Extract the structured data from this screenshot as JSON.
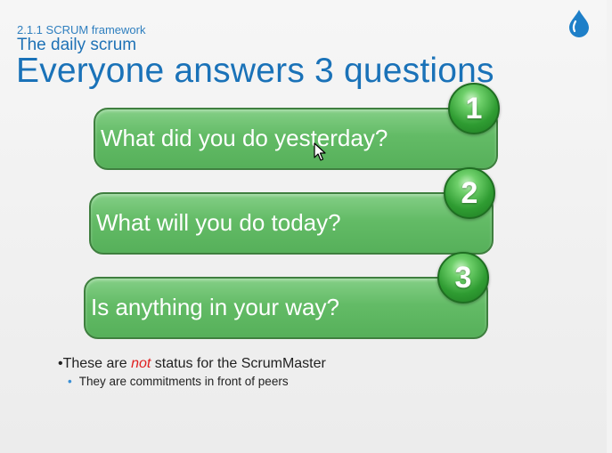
{
  "slide": {
    "section_label": "2.1.1 SCRUM framework",
    "subtitle": "The daily scrum",
    "title": "Everyone answers 3 questions"
  },
  "questions": [
    {
      "number": "1",
      "text": "What did you do yesterday?"
    },
    {
      "number": "2",
      "text": "What will you do today?"
    },
    {
      "number": "3",
      "text": "Is anything in your way?"
    }
  ],
  "bullets": {
    "main_prefix": "•These are ",
    "main_emphasis": "not",
    "main_suffix": " status for the ScrumMaster",
    "sub_marker": "•",
    "sub": "They are commitments in front of peers"
  },
  "colors": {
    "title_blue": "#1a72b8",
    "box_green": "#63bb66",
    "emphasis_red": "#e02020"
  },
  "icons": {
    "logo": "blue-droplet-logo",
    "cursor": "mouse-pointer-icon"
  }
}
